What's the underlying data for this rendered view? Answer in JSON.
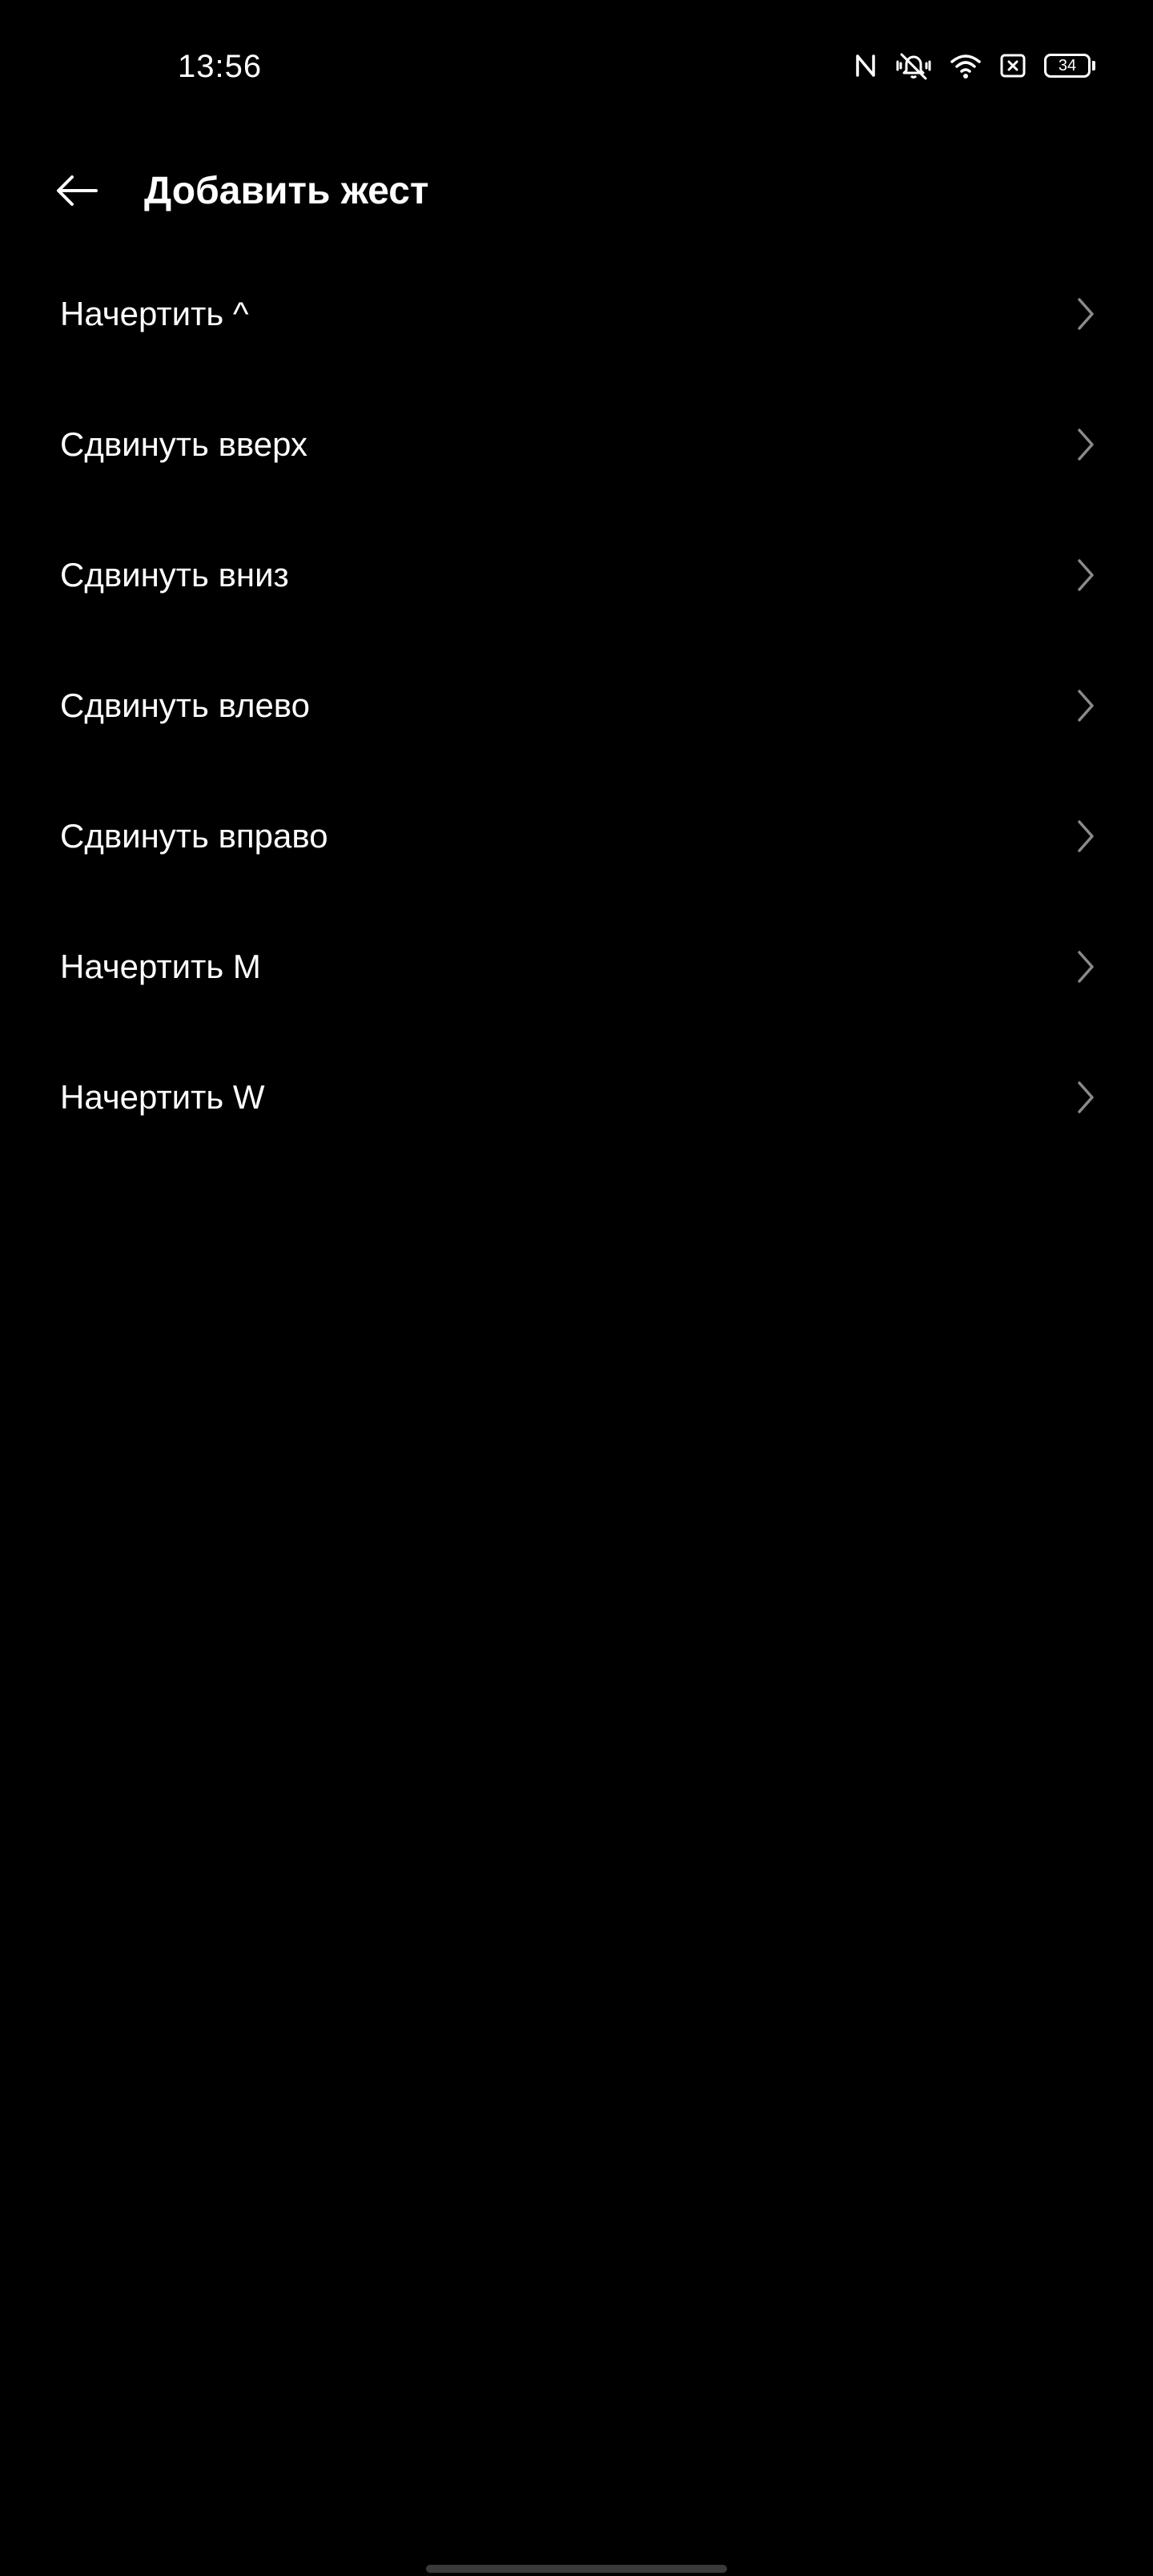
{
  "status_bar": {
    "time": "13:56",
    "battery_level": "34",
    "icons": [
      "nfc-icon",
      "vibrate-silent-icon",
      "wifi-icon",
      "no-sim-icon",
      "battery-icon"
    ]
  },
  "app_bar": {
    "title": "Добавить жест",
    "back_icon": "arrow-left-icon"
  },
  "gestures": [
    {
      "label": "Начертить ^"
    },
    {
      "label": "Сдвинуть вверх"
    },
    {
      "label": "Сдвинуть вниз"
    },
    {
      "label": "Сдвинуть влево"
    },
    {
      "label": "Сдвинуть вправо"
    },
    {
      "label": "Начертить M"
    },
    {
      "label": "Начертить W"
    }
  ],
  "colors": {
    "background": "#000000",
    "text": "#ffffff",
    "chevron": "#8a8a8a",
    "nav_handle": "#3a3a3a"
  }
}
